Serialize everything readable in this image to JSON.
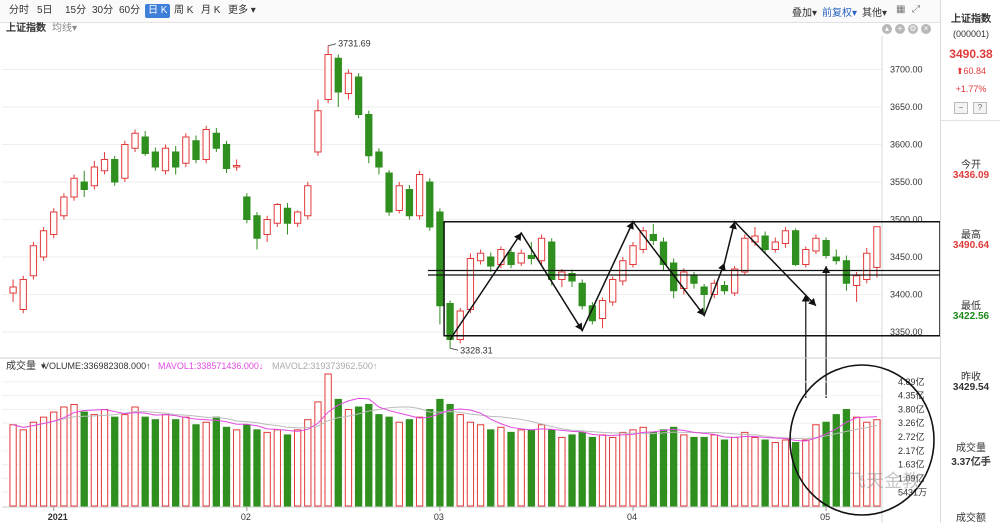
{
  "toolbar": {
    "periods": [
      "分时",
      "5日",
      "15分",
      "30分",
      "60分",
      "日 K",
      "周 K",
      "月 K",
      "更多"
    ],
    "active_index": 5,
    "overlay_label": "叠加",
    "adjust_label": "前复权",
    "other_label": "其他"
  },
  "price_header": {
    "name": "上证指数",
    "ma_label": "均线"
  },
  "volume_header": {
    "label": "成交量",
    "volume": "VOLUME:336982308.000↑",
    "mavol1": "MAVOL1:338571436.000↓",
    "mavol2": "MAVOL2:319373962.500↑"
  },
  "side": {
    "name": "上证指数",
    "code": "(000001)",
    "price": "3490.38",
    "change": "⬆60.84",
    "change_pct": "+1.77%",
    "open_label": "今开",
    "open_value": "3436.09",
    "high_label": "最高",
    "high_value": "3490.64",
    "low_label": "最低",
    "low_value": "3422.56",
    "prev_label": "昨收",
    "prev_value": "3429.54",
    "vol_label": "成交量",
    "vol_value": "3.37亿手",
    "amount_label": "成交额"
  },
  "watermark": "飞天金教",
  "colors": {
    "up": "#e23a3a",
    "down": "#2f8f1f",
    "mavol1": "#e14be0",
    "mavol2": "#bbbbbb",
    "axis": "#cfcfcf"
  },
  "chart_data": [
    {
      "type": "candlestick",
      "title": "上证指数",
      "y_ticks": [
        3350,
        3400,
        3450,
        3500,
        3550,
        3600,
        3650,
        3700
      ],
      "y_tick_labels": [
        "3350.00",
        "3400.00",
        "3450.00",
        "3500.00",
        "3550.00",
        "3600.00",
        "3650.00",
        "3700.00"
      ],
      "ylim": [
        3318,
        3742
      ],
      "x_tick_labels": [
        "2021",
        "02",
        "03",
        "04",
        "05"
      ],
      "x_tick_index": [
        4,
        23,
        42,
        61,
        80
      ],
      "annotations": [
        {
          "label": "3731.69",
          "index": 31
        },
        {
          "label": "3328.31",
          "index": 43
        }
      ],
      "candles": [
        [
          3402,
          3410,
          3390,
          3420
        ],
        [
          3380,
          3420,
          3375,
          3425
        ],
        [
          3425,
          3465,
          3420,
          3470
        ],
        [
          3450,
          3485,
          3445,
          3490
        ],
        [
          3480,
          3510,
          3475,
          3515
        ],
        [
          3505,
          3530,
          3500,
          3535
        ],
        [
          3530,
          3555,
          3525,
          3560
        ],
        [
          3550,
          3540,
          3530,
          3565
        ],
        [
          3545,
          3570,
          3540,
          3578
        ],
        [
          3565,
          3580,
          3560,
          3590
        ],
        [
          3580,
          3550,
          3545,
          3585
        ],
        [
          3555,
          3600,
          3550,
          3605
        ],
        [
          3595,
          3615,
          3590,
          3620
        ],
        [
          3610,
          3588,
          3585,
          3618
        ],
        [
          3590,
          3570,
          3565,
          3596
        ],
        [
          3565,
          3595,
          3560,
          3600
        ],
        [
          3590,
          3570,
          3560,
          3598
        ],
        [
          3575,
          3610,
          3570,
          3615
        ],
        [
          3605,
          3580,
          3575,
          3612
        ],
        [
          3580,
          3620,
          3575,
          3625
        ],
        [
          3615,
          3595,
          3590,
          3622
        ],
        [
          3600,
          3568,
          3562,
          3605
        ],
        [
          3570,
          3572,
          3565,
          3580
        ],
        [
          3530,
          3500,
          3495,
          3535
        ],
        [
          3505,
          3475,
          3460,
          3510
        ],
        [
          3480,
          3500,
          3470,
          3505
        ],
        [
          3495,
          3520,
          3490,
          3522
        ],
        [
          3515,
          3495,
          3480,
          3522
        ],
        [
          3495,
          3510,
          3490,
          3512
        ],
        [
          3505,
          3545,
          3500,
          3550
        ],
        [
          3590,
          3645,
          3585,
          3660
        ],
        [
          3660,
          3720,
          3655,
          3731.69
        ],
        [
          3715,
          3670,
          3650,
          3720
        ],
        [
          3668,
          3695,
          3660,
          3700
        ],
        [
          3690,
          3640,
          3635,
          3695
        ],
        [
          3640,
          3585,
          3575,
          3645
        ],
        [
          3590,
          3570,
          3560,
          3595
        ],
        [
          3562,
          3510,
          3505,
          3566
        ],
        [
          3512,
          3545,
          3508,
          3550
        ],
        [
          3540,
          3505,
          3500,
          3546
        ],
        [
          3505,
          3560,
          3500,
          3565
        ],
        [
          3550,
          3490,
          3485,
          3555
        ],
        [
          3510,
          3385,
          3360,
          3515
        ],
        [
          3388,
          3340,
          3328.31,
          3392
        ],
        [
          3340,
          3378,
          3335,
          3382
        ],
        [
          3380,
          3448,
          3375,
          3455
        ],
        [
          3445,
          3455,
          3440,
          3460
        ],
        [
          3450,
          3438,
          3430,
          3456
        ],
        [
          3440,
          3460,
          3435,
          3464
        ],
        [
          3456,
          3440,
          3435,
          3460
        ],
        [
          3442,
          3455,
          3438,
          3460
        ],
        [
          3452,
          3448,
          3440,
          3470
        ],
        [
          3445,
          3475,
          3440,
          3480
        ],
        [
          3470,
          3420,
          3412,
          3475
        ],
        [
          3420,
          3430,
          3410,
          3434
        ],
        [
          3428,
          3418,
          3410,
          3433
        ],
        [
          3415,
          3385,
          3380,
          3420
        ],
        [
          3385,
          3365,
          3360,
          3390
        ],
        [
          3368,
          3392,
          3355,
          3396
        ],
        [
          3390,
          3420,
          3385,
          3424
        ],
        [
          3418,
          3445,
          3412,
          3450
        ],
        [
          3440,
          3465,
          3436,
          3470
        ],
        [
          3460,
          3485,
          3455,
          3490
        ],
        [
          3480,
          3472,
          3466,
          3494
        ],
        [
          3470,
          3440,
          3432,
          3476
        ],
        [
          3442,
          3405,
          3395,
          3448
        ],
        [
          3408,
          3430,
          3400,
          3435
        ],
        [
          3425,
          3415,
          3408,
          3430
        ],
        [
          3410,
          3400,
          3372,
          3414
        ],
        [
          3400,
          3415,
          3395,
          3420
        ],
        [
          3412,
          3405,
          3400,
          3418
        ],
        [
          3402,
          3434,
          3398,
          3438
        ],
        [
          3430,
          3475,
          3426,
          3480
        ],
        [
          3470,
          3478,
          3465,
          3490
        ],
        [
          3478,
          3460,
          3455,
          3484
        ],
        [
          3460,
          3470,
          3456,
          3476
        ],
        [
          3468,
          3485,
          3462,
          3490
        ],
        [
          3485,
          3440,
          3438,
          3488
        ],
        [
          3440,
          3460,
          3436,
          3464
        ],
        [
          3458,
          3475,
          3454,
          3480
        ],
        [
          3472,
          3452,
          3448,
          3476
        ],
        [
          3450,
          3445,
          3440,
          3460
        ],
        [
          3445,
          3415,
          3405,
          3452
        ],
        [
          3412,
          3425,
          3390,
          3430
        ],
        [
          3420,
          3455,
          3415,
          3462
        ],
        [
          3436.09,
          3490.38,
          3422.56,
          3490.64
        ]
      ]
    },
    {
      "type": "bar",
      "title": "成交量",
      "y_ticks": [
        0.54,
        1.09,
        1.63,
        2.17,
        2.72,
        3.26,
        3.8,
        4.35,
        4.89
      ],
      "y_tick_labels": [
        "5431万",
        "1.09亿",
        "1.63亿",
        "2.17亿",
        "2.72亿",
        "3.26亿",
        "3.80亿",
        "4.35亿",
        "4.89亿"
      ],
      "ylim": [
        0,
        5.2
      ],
      "unit": "亿",
      "volumes": [
        3.2,
        3.0,
        3.3,
        3.5,
        3.7,
        3.9,
        4.0,
        3.7,
        3.6,
        3.8,
        3.5,
        3.6,
        3.9,
        3.5,
        3.4,
        3.6,
        3.4,
        3.5,
        3.2,
        3.3,
        3.5,
        3.1,
        3.0,
        3.2,
        3.0,
        2.9,
        3.0,
        2.8,
        3.0,
        3.4,
        4.1,
        5.2,
        4.2,
        3.8,
        3.9,
        4.0,
        3.6,
        3.5,
        3.3,
        3.4,
        3.5,
        3.8,
        4.2,
        4.0,
        3.6,
        3.3,
        3.2,
        3.0,
        3.1,
        2.9,
        3.0,
        3.0,
        3.2,
        3.0,
        2.7,
        2.8,
        2.9,
        2.7,
        2.8,
        2.7,
        2.9,
        3.0,
        3.1,
        2.9,
        3.0,
        3.1,
        2.8,
        2.7,
        2.7,
        2.8,
        2.6,
        2.7,
        2.9,
        2.7,
        2.6,
        2.5,
        2.6,
        2.5,
        2.6,
        3.2,
        3.3,
        3.6,
        3.8,
        3.5,
        3.3,
        3.4
      ]
    }
  ]
}
